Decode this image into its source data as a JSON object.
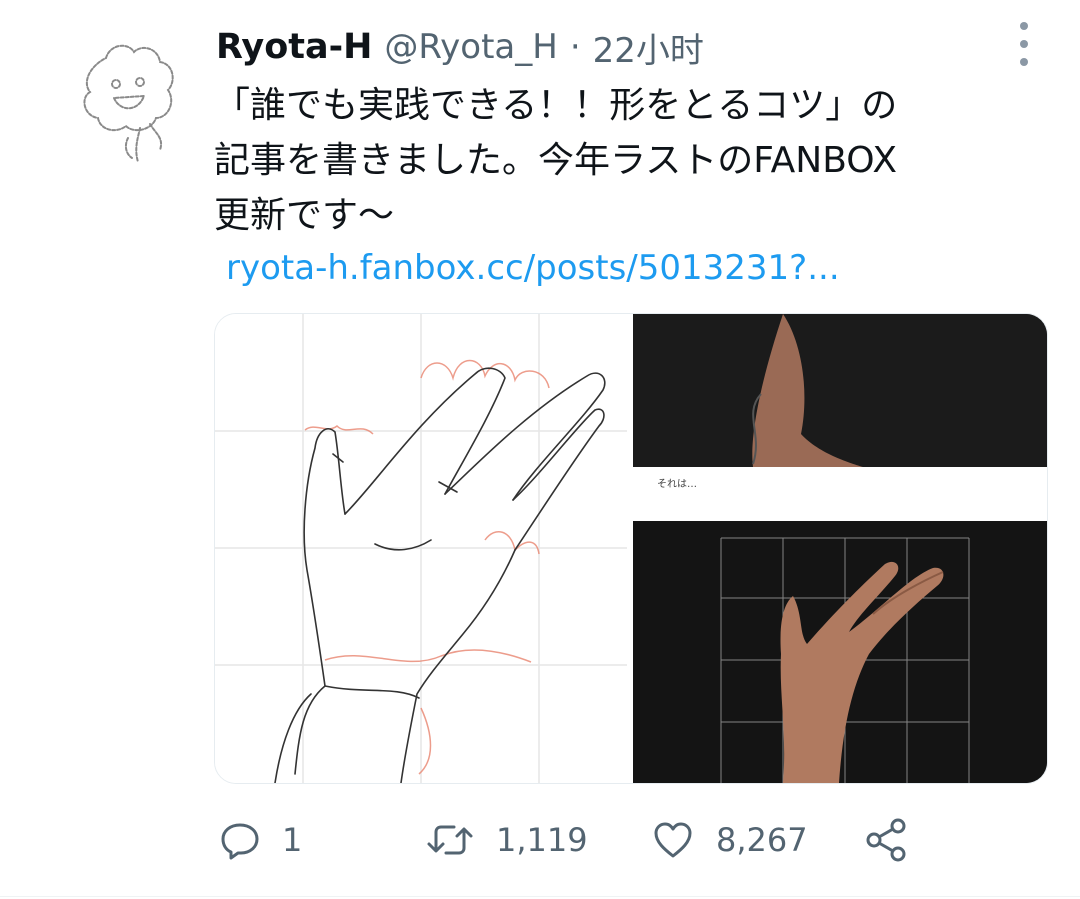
{
  "tweet": {
    "author_name": "Ryota-H",
    "author_handle": "@Ryota_H",
    "meta_separator": "·",
    "time_ago": "22小时",
    "text_lines": [
      "「誰でも実践できる！！形をとるコツ」の",
      "記事を書きました。今年ラストのFANBOX",
      "更新です〜"
    ],
    "link_text": "ryota-h.fanbox.cc/posts/5013231?...",
    "media": {
      "caption": "それは…"
    }
  },
  "actions": {
    "reply": {
      "icon": "reply-icon",
      "count": "1"
    },
    "retweet": {
      "icon": "retweet-icon",
      "count": "1,119"
    },
    "like": {
      "icon": "heart-icon",
      "count": "8,267"
    },
    "share": {
      "icon": "share-icon"
    }
  },
  "colors": {
    "text": "#0f1419",
    "secondary": "#536471",
    "link": "#1d9bf0",
    "grid_guides": "#e8846f"
  }
}
